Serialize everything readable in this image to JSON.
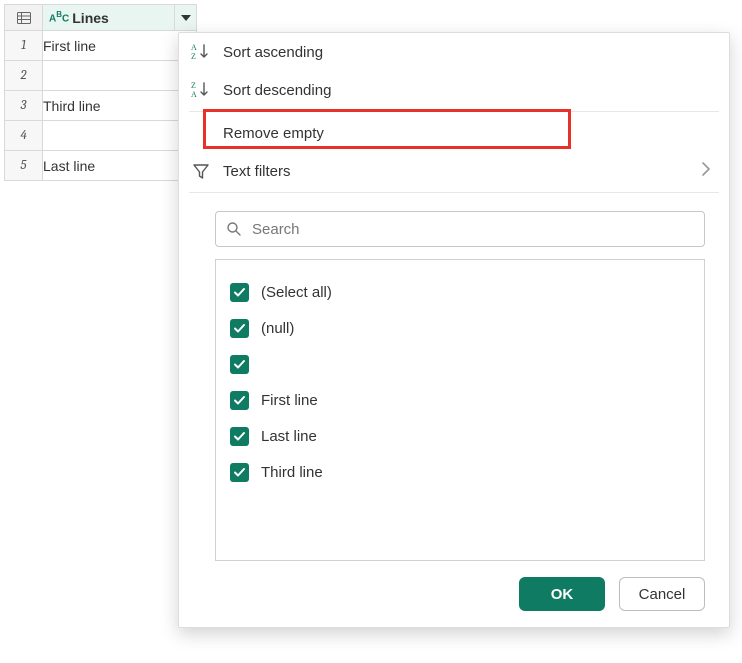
{
  "column": {
    "header": "Lines",
    "type_label": "ABC",
    "rows": [
      {
        "n": "1",
        "value": "First line"
      },
      {
        "n": "2",
        "value": ""
      },
      {
        "n": "3",
        "value": "Third line"
      },
      {
        "n": "4",
        "value": ""
      },
      {
        "n": "5",
        "value": "Last line"
      }
    ]
  },
  "menu": {
    "sort_asc": "Sort ascending",
    "sort_desc": "Sort descending",
    "remove_empty": "Remove empty",
    "text_filters": "Text filters"
  },
  "search": {
    "placeholder": "Search"
  },
  "filter_items": [
    {
      "label": "(Select all)",
      "checked": true
    },
    {
      "label": "(null)",
      "checked": true
    },
    {
      "label": "",
      "checked": true
    },
    {
      "label": "First line",
      "checked": true
    },
    {
      "label": "Last line",
      "checked": true
    },
    {
      "label": "Third line",
      "checked": true
    }
  ],
  "buttons": {
    "ok": "OK",
    "cancel": "Cancel"
  }
}
